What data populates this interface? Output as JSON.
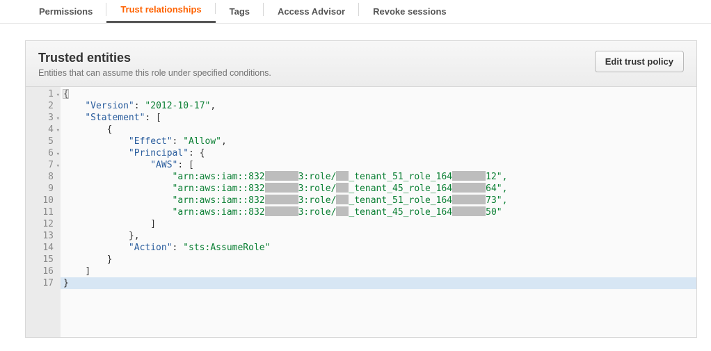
{
  "tabs": [
    {
      "label": "Permissions",
      "active": false
    },
    {
      "label": "Trust relationships",
      "active": true
    },
    {
      "label": "Tags",
      "active": false
    },
    {
      "label": "Access Advisor",
      "active": false
    },
    {
      "label": "Revoke sessions",
      "active": false
    }
  ],
  "panel": {
    "title": "Trusted entities",
    "subtitle": "Entities that can assume this role under specified conditions.",
    "edit_label": "Edit trust policy"
  },
  "lines": {
    "l01": "{",
    "l02_k": "\"Version\"",
    "l02_v": "\"2012-10-17\"",
    "l03_k": "\"Statement\"",
    "l05_k": "\"Effect\"",
    "l05_v": "\"Allow\"",
    "l06_k": "\"Principal\"",
    "l07_k": "\"AWS\"",
    "l08_a": "\"arn:aws:iam::832",
    "l08_b": "3:role/",
    "l08_c": "_tenant_51_role_164",
    "l08_d": "12\",",
    "l09_a": "\"arn:aws:iam::832",
    "l09_b": "3:role/",
    "l09_c": "_tenant_45_role_164",
    "l09_d": "64\",",
    "l10_a": "\"arn:aws:iam::832",
    "l10_b": "3:role/",
    "l10_c": "_tenant_51_role_164",
    "l10_d": "73\",",
    "l11_a": "\"arn:aws:iam::832",
    "l11_b": "3:role/",
    "l11_c": "_tenant_45_role_164",
    "l11_d": "50\"",
    "l14_k": "\"Action\"",
    "l14_v": "\"sts:AssumeRole\""
  }
}
